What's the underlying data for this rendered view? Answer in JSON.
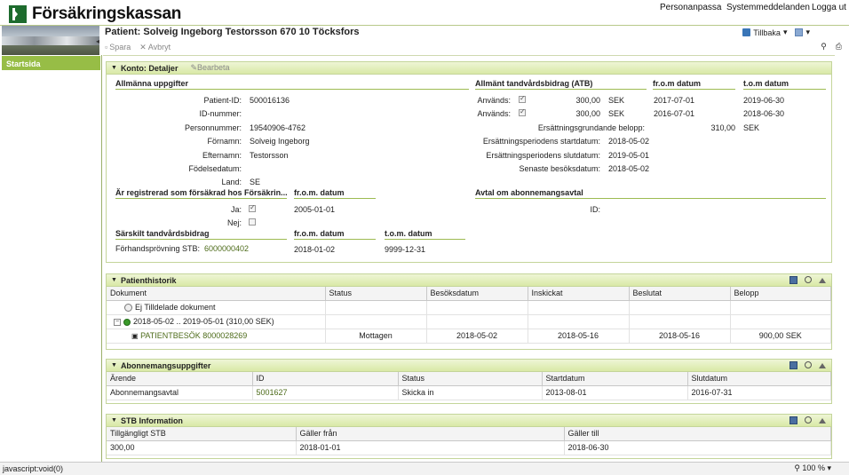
{
  "header": {
    "app_name": "Försäkringskassan",
    "links": [
      "Personanpassa",
      "Systemmeddelanden",
      "Logga ut"
    ],
    "title": "Patient: Solveig Ingeborg Testorsson 670 10 Töcksfors",
    "back_label": "Tillbaka",
    "toolbar": {
      "save": "Spara",
      "cancel": "Avbryt"
    }
  },
  "sidebar": {
    "start": "Startsida"
  },
  "konto": {
    "title": "Konto: Detaljer",
    "edit": "Bearbeta",
    "general": {
      "heading": "Allmänna uppgifter",
      "rows": [
        {
          "label": "Patient-ID:",
          "value": "500016136"
        },
        {
          "label": "ID-nummer:",
          "value": ""
        },
        {
          "label": "Personnummer:",
          "value": "19540906-4762"
        },
        {
          "label": "Förnamn:",
          "value": "Solveig Ingeborg"
        },
        {
          "label": "Efternamn:",
          "value": "Testorsson"
        },
        {
          "label": "Födelsedatum:",
          "value": ""
        },
        {
          "label": "Land:",
          "value": "SE"
        }
      ]
    },
    "atb": {
      "heading": "Allmänt tandvårdsbidrag (ATB)",
      "from_heading": "fr.o.m datum",
      "to_heading": "t.o.m datum",
      "rows": [
        {
          "label": "Används:",
          "amount": "300,00",
          "currency": "SEK",
          "from": "2017-07-01",
          "to": "2019-06-30"
        },
        {
          "label": "Används:",
          "amount": "300,00",
          "currency": "SEK",
          "from": "2016-07-01",
          "to": "2018-06-30"
        }
      ],
      "base_label": "Ersättningsgrundande belopp:",
      "base_amount": "310,00",
      "base_currency": "SEK",
      "period_start_label": "Ersättningsperiodens startdatum:",
      "period_start": "2018-05-02",
      "period_end_label": "Ersättningsperiodens slutdatum:",
      "period_end": "2019-05-01",
      "last_visit_label": "Senaste besöksdatum:",
      "last_visit": "2018-05-02"
    },
    "insured": {
      "heading": "Är registrerad som försäkrad hos Försäkrin...",
      "from_heading": "fr.o.m. datum",
      "yes_label": "Ja:",
      "no_label": "Nej:",
      "yes_from": "2005-01-01"
    },
    "stb": {
      "heading": "Särskilt tandvårdsbidrag",
      "from_heading": "fr.o.m. datum",
      "to_heading": "t.o.m. datum",
      "label": "Förhandsprövning STB:",
      "value": "6000000402",
      "from": "2018-01-02",
      "to": "9999-12-31"
    },
    "subscription": {
      "heading": "Avtal om abonnemangsavtal",
      "id_label": "ID:"
    }
  },
  "history": {
    "title": "Patienthistorik",
    "columns": [
      "Dokument",
      "Status",
      "Besöksdatum",
      "Inskickat",
      "Beslutat",
      "Belopp"
    ],
    "unassigned": "Ej Tilldelade dokument",
    "period": "2018-05-02 .. 2019-05-01 (310,00 SEK)",
    "row": {
      "doc": "PATIENTBESÖK 8000028269",
      "status": "Mottagen",
      "visit": "2018-05-02",
      "sent": "2018-05-16",
      "decided": "2018-05-16",
      "amount": "900,00 SEK"
    }
  },
  "subscriptions": {
    "title": "Abonnemangsuppgifter",
    "columns": [
      "Ärende",
      "ID",
      "Status",
      "Startdatum",
      "Slutdatum"
    ],
    "row": {
      "case": "Abonnemangsavtal",
      "id": "5001627",
      "status": "Skicka in",
      "start": "2013-08-01",
      "end": "2016-07-31"
    }
  },
  "stbinfo": {
    "title": "STB Information",
    "columns": [
      "Tillgängligt STB",
      "Gäller från",
      "Gäller till"
    ],
    "row": {
      "available": "300,00",
      "from": "2018-01-01",
      "to": "2018-06-30"
    }
  },
  "statusbar": {
    "text": "javascript:void(0)",
    "zoom": "100 %"
  }
}
